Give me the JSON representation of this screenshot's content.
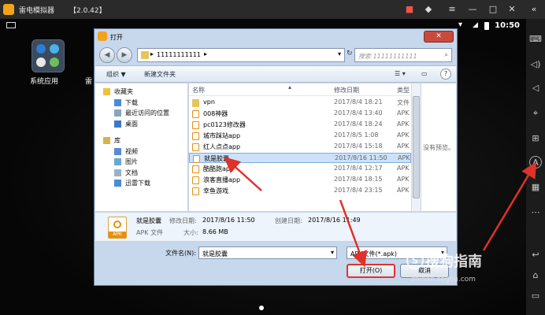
{
  "emulator": {
    "title": "雷电模拟器",
    "version": "【2.0.42】",
    "time": "10:50"
  },
  "desktop": {
    "app_label": "系统应用",
    "app_label2": "雷"
  },
  "dialog": {
    "title": "打开",
    "address": "11111111111",
    "search_placeholder": "搜索 11111111111",
    "toolbar": {
      "organize": "组织 ▼",
      "new_folder": "新建文件夹"
    },
    "tree": [
      {
        "label": "收藏夹",
        "icon": "star",
        "top": true
      },
      {
        "label": "下载",
        "icon": "download"
      },
      {
        "label": "最近访问的位置",
        "icon": "recent"
      },
      {
        "label": "桌面",
        "icon": "desktop"
      },
      {
        "label": "库",
        "icon": "library",
        "top": true
      },
      {
        "label": "视频",
        "icon": "video"
      },
      {
        "label": "图片",
        "icon": "picture"
      },
      {
        "label": "文档",
        "icon": "document"
      },
      {
        "label": "迅雷下载",
        "icon": "download"
      }
    ],
    "columns": {
      "name": "名称",
      "date": "修改日期",
      "type": "类型"
    },
    "files": [
      {
        "name": "vpn",
        "date": "2017/8/4 18:21",
        "type": "文件",
        "kind": "folder"
      },
      {
        "name": "008神器",
        "date": "2017/8/4 13:40",
        "type": "APK",
        "kind": "apk"
      },
      {
        "name": "pc0123修改器",
        "date": "2017/8/4 18:24",
        "type": "APK",
        "kind": "apk"
      },
      {
        "name": "城市踩站app",
        "date": "2017/8/5 1:08",
        "type": "APK",
        "kind": "apk"
      },
      {
        "name": "红人点点app",
        "date": "2017/8/4 15:18",
        "type": "APK",
        "kind": "apk"
      },
      {
        "name": "就是胶囊",
        "date": "2017/8/16 11:50",
        "type": "APK",
        "kind": "apk",
        "selected": true
      },
      {
        "name": "酷酷跑app",
        "date": "2017/8/4 12:17",
        "type": "APK",
        "kind": "apk"
      },
      {
        "name": "浪客直播app",
        "date": "2017/8/4 18:15",
        "type": "APK",
        "kind": "apk"
      },
      {
        "name": "幸鱼游戏",
        "date": "2017/8/4 23:15",
        "type": "APK",
        "kind": "apk"
      }
    ],
    "preview_text": "没有预览。",
    "details": {
      "name": "就是胶囊",
      "modified_label": "修改日期:",
      "modified": "2017/8/16 11:50",
      "created_label": "创建日期:",
      "created": "2017/8/16 11:49",
      "type": "APK 文件",
      "size_label": "大小:",
      "size": "8.66 MB",
      "badge": "APK"
    },
    "filename_label": "文件名(N):",
    "filename_value": "就是胶囊",
    "filetype": "APK文件(*.apk)",
    "open_button": "打开(O)",
    "cancel_button": "取消"
  },
  "watermark": {
    "text": "搜狗指南",
    "url": "zhinan.sogou.com"
  },
  "colors": {
    "accent": "#f3a21b",
    "arrow": "#e0312b",
    "selection": "#cce2fa"
  }
}
